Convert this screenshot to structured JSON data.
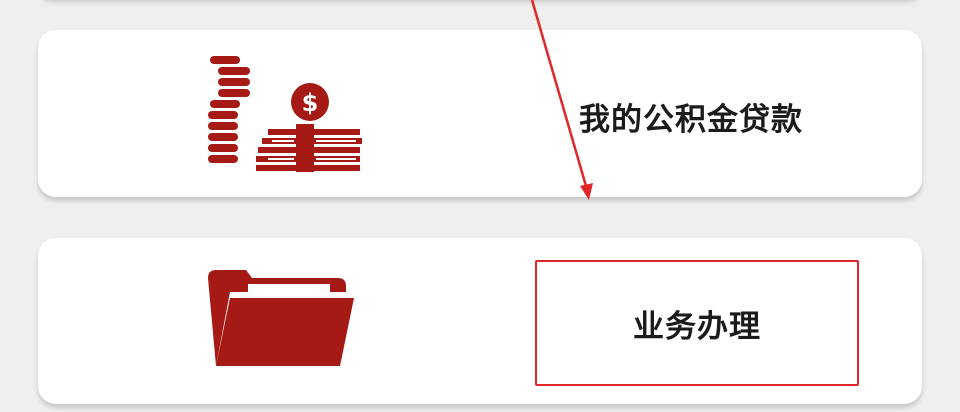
{
  "colors": {
    "icon_red": "#a51a14",
    "annotation_red": "#e0282a",
    "card_bg": "#ffffff",
    "page_bg": "#efefef",
    "text": "#1b1b1b"
  },
  "cards": [
    {
      "label": "我的公积金贷款",
      "icon": "coins-money-icon"
    },
    {
      "label": "业务办理",
      "icon": "folder-icon"
    }
  ],
  "annotation": {
    "type": "arrow-and-highlight-box",
    "target": "业务办理"
  }
}
